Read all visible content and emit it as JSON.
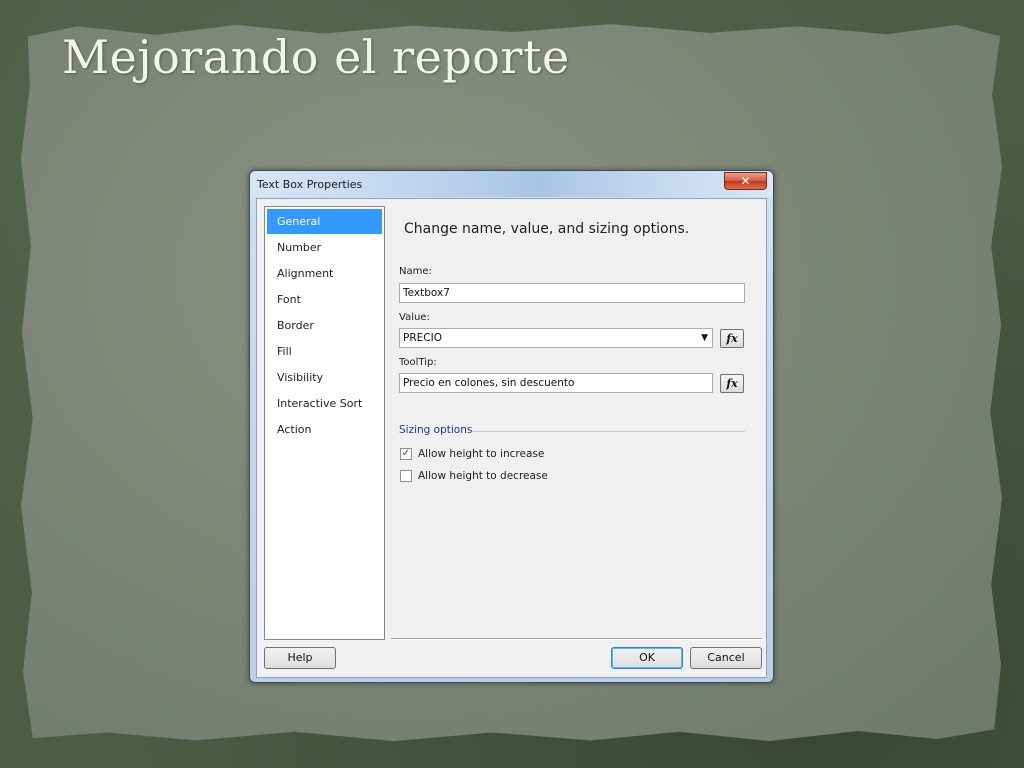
{
  "slide": {
    "title": "Mejorando el reporte"
  },
  "dialog": {
    "title": "Text Box Properties",
    "close_glyph": "✕",
    "nav_items": [
      {
        "label": "General",
        "selected": true
      },
      {
        "label": "Number"
      },
      {
        "label": "Alignment"
      },
      {
        "label": "Font"
      },
      {
        "label": "Border"
      },
      {
        "label": "Fill"
      },
      {
        "label": "Visibility"
      },
      {
        "label": "Interactive Sort"
      },
      {
        "label": "Action"
      }
    ],
    "heading": "Change name, value, and sizing options.",
    "name_label": "Name:",
    "name_value": "Textbox7",
    "value_label": "Value:",
    "value_value": "PRECIO",
    "tooltip_label": "ToolTip:",
    "tooltip_value": "Precio en colones, sin descuento",
    "fx_label": "fx",
    "sizing_group": "Sizing options",
    "allow_increase_label": "Allow height to increase",
    "allow_increase_checked": true,
    "allow_decrease_label": "Allow height to decrease",
    "allow_decrease_checked": false,
    "help_label": "Help",
    "ok_label": "OK",
    "cancel_label": "Cancel",
    "colors": {
      "selected_nav": "#3399ff",
      "group_label": "#1a3a8c",
      "close_button": "#c2391c"
    }
  }
}
